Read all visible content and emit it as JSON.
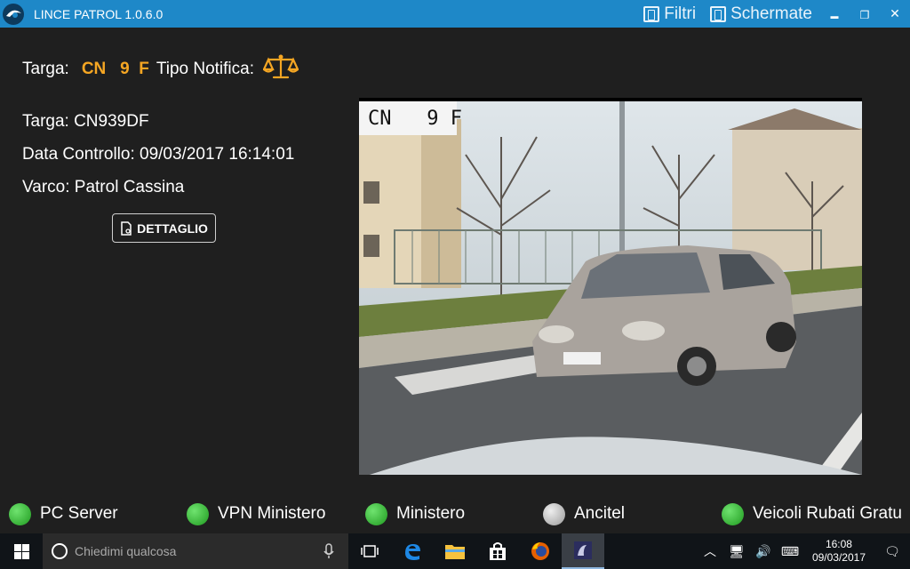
{
  "window": {
    "title": "LINCE PATROL 1.0.6.0",
    "filters_label": "Filtri",
    "screens_label": "Schermate",
    "minimize": "▬",
    "maximize": "❐",
    "close": "✕"
  },
  "header": {
    "targa_label": "Targa:",
    "targa_value": "CN   9  F",
    "tipo_label": "Tipo Notifica:",
    "tipo_icon": "scale-icon"
  },
  "details": {
    "targa": "Targa: CN939DF",
    "data_controllo": "Data Controllo: 09/03/2017 16:14:01",
    "varco": "Varco: Patrol Cassina",
    "button_label": "DETTAGLIO"
  },
  "photo": {
    "plate_crop_text": "CN   9 F"
  },
  "status": [
    {
      "label": "PC Server",
      "color": "#2db52d"
    },
    {
      "label": "VPN Ministero",
      "color": "#2db52d"
    },
    {
      "label": "Ministero",
      "color": "#2db52d"
    },
    {
      "label": "Ancitel",
      "color": "#b8b8b8"
    },
    {
      "label": "Veicoli Rubati Gratu",
      "color": "#2db52d"
    }
  ],
  "taskbar": {
    "search_placeholder": "Chiedimi qualcosa",
    "time": "16:08",
    "date": "09/03/2017"
  },
  "colors": {
    "titlebar": "#1e88c8",
    "accent": "#f5a623",
    "background": "#1f1f1f"
  }
}
